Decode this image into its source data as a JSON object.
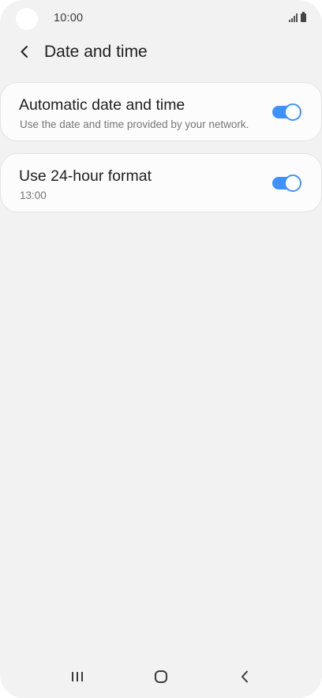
{
  "status_bar": {
    "time": "10:00"
  },
  "header": {
    "title": "Date and time",
    "back_icon": "chevron-left-icon"
  },
  "settings": [
    {
      "title": "Automatic date and time",
      "subtitle": "Use the date and time provided by your network.",
      "toggle_on": true
    },
    {
      "title": "Use 24-hour format",
      "subtitle": "13:00",
      "toggle_on": true
    }
  ],
  "nav_bar": {
    "icons": [
      "recents-icon",
      "home-icon",
      "back-icon"
    ]
  },
  "colors": {
    "accent": "#3e91ff",
    "background": "#f2f2f2",
    "card": "#fcfcfc"
  }
}
